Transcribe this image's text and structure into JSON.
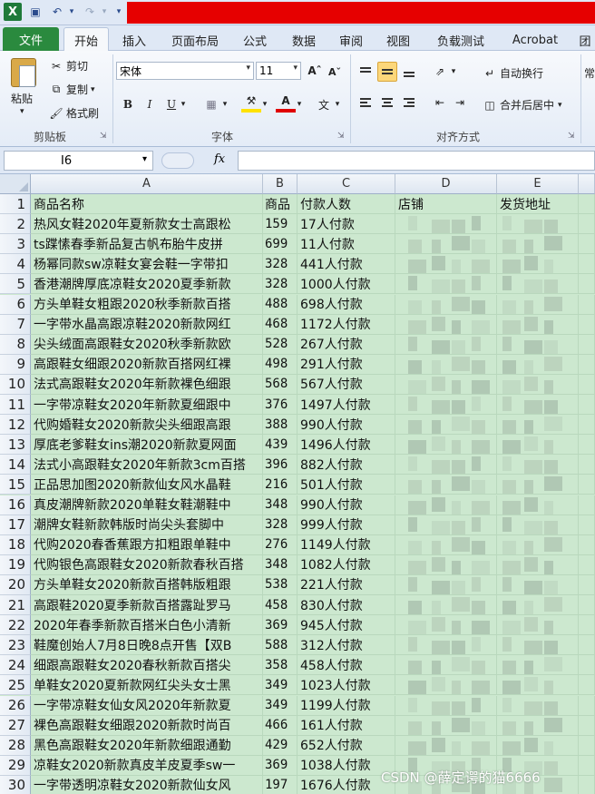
{
  "toolbar": {
    "tabs": [
      "文件",
      "开始",
      "插入",
      "页面布局",
      "公式",
      "数据",
      "审阅",
      "视图",
      "负载测试",
      "Acrobat",
      "团"
    ],
    "active_tab": "开始",
    "clipboard": {
      "paste": "粘贴",
      "cut": "剪切",
      "copy": "复制",
      "format_painter": "格式刷",
      "label": "剪贴板"
    },
    "font": {
      "name": "宋体",
      "size": "11",
      "label": "字体"
    },
    "alignment": {
      "wrap": "自动换行",
      "merge": "合并后居中",
      "label": "对齐方式"
    },
    "number_format": "常"
  },
  "formula_bar": {
    "name_box": "I6",
    "fx": "fx",
    "formula": ""
  },
  "sheet": {
    "columns": [
      "A",
      "B",
      "C",
      "D",
      "E"
    ],
    "header_row": {
      "num": "1",
      "a": "商品名称",
      "b": "商品",
      "c": "付款人数",
      "d": "店铺",
      "e": "发货地址"
    },
    "rows": [
      {
        "num": "2",
        "a": "热风女鞋2020年夏新款女士高跟松",
        "b": "159",
        "c": "17人付款"
      },
      {
        "num": "3",
        "a": "ts蹀愫春季新品复古帆布胎牛皮拼",
        "b": "699",
        "c": "11人付款"
      },
      {
        "num": "4",
        "a": "杨幂同款sw凉鞋女宴会鞋一字带扣",
        "b": "328",
        "c": "441人付款"
      },
      {
        "num": "5",
        "a": "香港潮牌厚底凉鞋女2020夏季新款",
        "b": "328",
        "c": "1000人付款"
      },
      {
        "num": "6",
        "a": "方头单鞋女粗跟2020秋季新款百搭",
        "b": "488",
        "c": "698人付款"
      },
      {
        "num": "7",
        "a": "一字带水晶高跟凉鞋2020新款网红",
        "b": "468",
        "c": "1172人付款"
      },
      {
        "num": "8",
        "a": "尖头绒面高跟鞋女2020秋季新款欧",
        "b": "528",
        "c": "267人付款"
      },
      {
        "num": "9",
        "a": "高跟鞋女细跟2020新款百搭网红裸",
        "b": "498",
        "c": "291人付款"
      },
      {
        "num": "10",
        "a": "法式高跟鞋女2020年新款裸色细跟",
        "b": "568",
        "c": "567人付款"
      },
      {
        "num": "11",
        "a": "一字带凉鞋女2020年新款夏细跟中",
        "b": "376",
        "c": "1497人付款"
      },
      {
        "num": "12",
        "a": "代购婚鞋女2020新款尖头细跟高跟",
        "b": "388",
        "c": "990人付款"
      },
      {
        "num": "13",
        "a": "厚底老爹鞋女ins潮2020新款夏网面",
        "b": "439",
        "c": "1496人付款"
      },
      {
        "num": "14",
        "a": "法式小高跟鞋女2020年新款3cm百搭",
        "b": "396",
        "b2": "",
        "c": "882人付款"
      },
      {
        "num": "15",
        "a": "正品思加图2020新款仙女风水晶鞋",
        "b": "216",
        "c": "501人付款"
      },
      {
        "num": "16",
        "a": "真皮潮牌新款2020单鞋女鞋潮鞋中",
        "b": "348",
        "c": "990人付款"
      },
      {
        "num": "17",
        "a": "潮牌女鞋新款韩版时尚尖头套脚中",
        "b": "328",
        "c": "999人付款"
      },
      {
        "num": "18",
        "a": "代购2020春香蕉跟方扣粗跟单鞋中",
        "b": "276",
        "c": "1149人付款"
      },
      {
        "num": "19",
        "a": "代购银色高跟鞋女2020新款春秋百搭",
        "b": "348",
        "c": "1082人付款"
      },
      {
        "num": "20",
        "a": "方头单鞋女2020新款百搭韩版粗跟",
        "b": "538",
        "c": "221人付款"
      },
      {
        "num": "21",
        "a": "高跟鞋2020夏季新款百搭露趾罗马",
        "b": "458",
        "c": "830人付款"
      },
      {
        "num": "22",
        "a": "2020年春季新款百搭米白色小清新",
        "b": "369",
        "c": "945人付款"
      },
      {
        "num": "23",
        "a": "鞋魔创始人7月8日晚8点开售【双B",
        "b": "588",
        "c": "312人付款"
      },
      {
        "num": "24",
        "a": "细跟高跟鞋女2020春秋新款百搭尖",
        "b": "358",
        "c": "458人付款"
      },
      {
        "num": "25",
        "a": "单鞋女2020夏新款网红尖头女士黑",
        "b": "349",
        "c": "1023人付款"
      },
      {
        "num": "26",
        "a": "一字带凉鞋女仙女风2020年新款夏",
        "b": "349",
        "c": "1199人付款"
      },
      {
        "num": "27",
        "a": "裸色高跟鞋女细跟2020新款时尚百",
        "b": "466",
        "c": "161人付款"
      },
      {
        "num": "28",
        "a": "黑色高跟鞋女2020年新款细跟通勤",
        "b": "429",
        "c": "652人付款"
      },
      {
        "num": "29",
        "a": "凉鞋女2020新款真皮羊皮夏季sw一",
        "b": "369",
        "c": "1038人付款"
      },
      {
        "num": "30",
        "a": "一字带透明凉鞋女2020新款仙女风",
        "b": "197",
        "c": "1676人付款"
      }
    ]
  },
  "watermark": "CSDN @薛定谔的猫6666"
}
